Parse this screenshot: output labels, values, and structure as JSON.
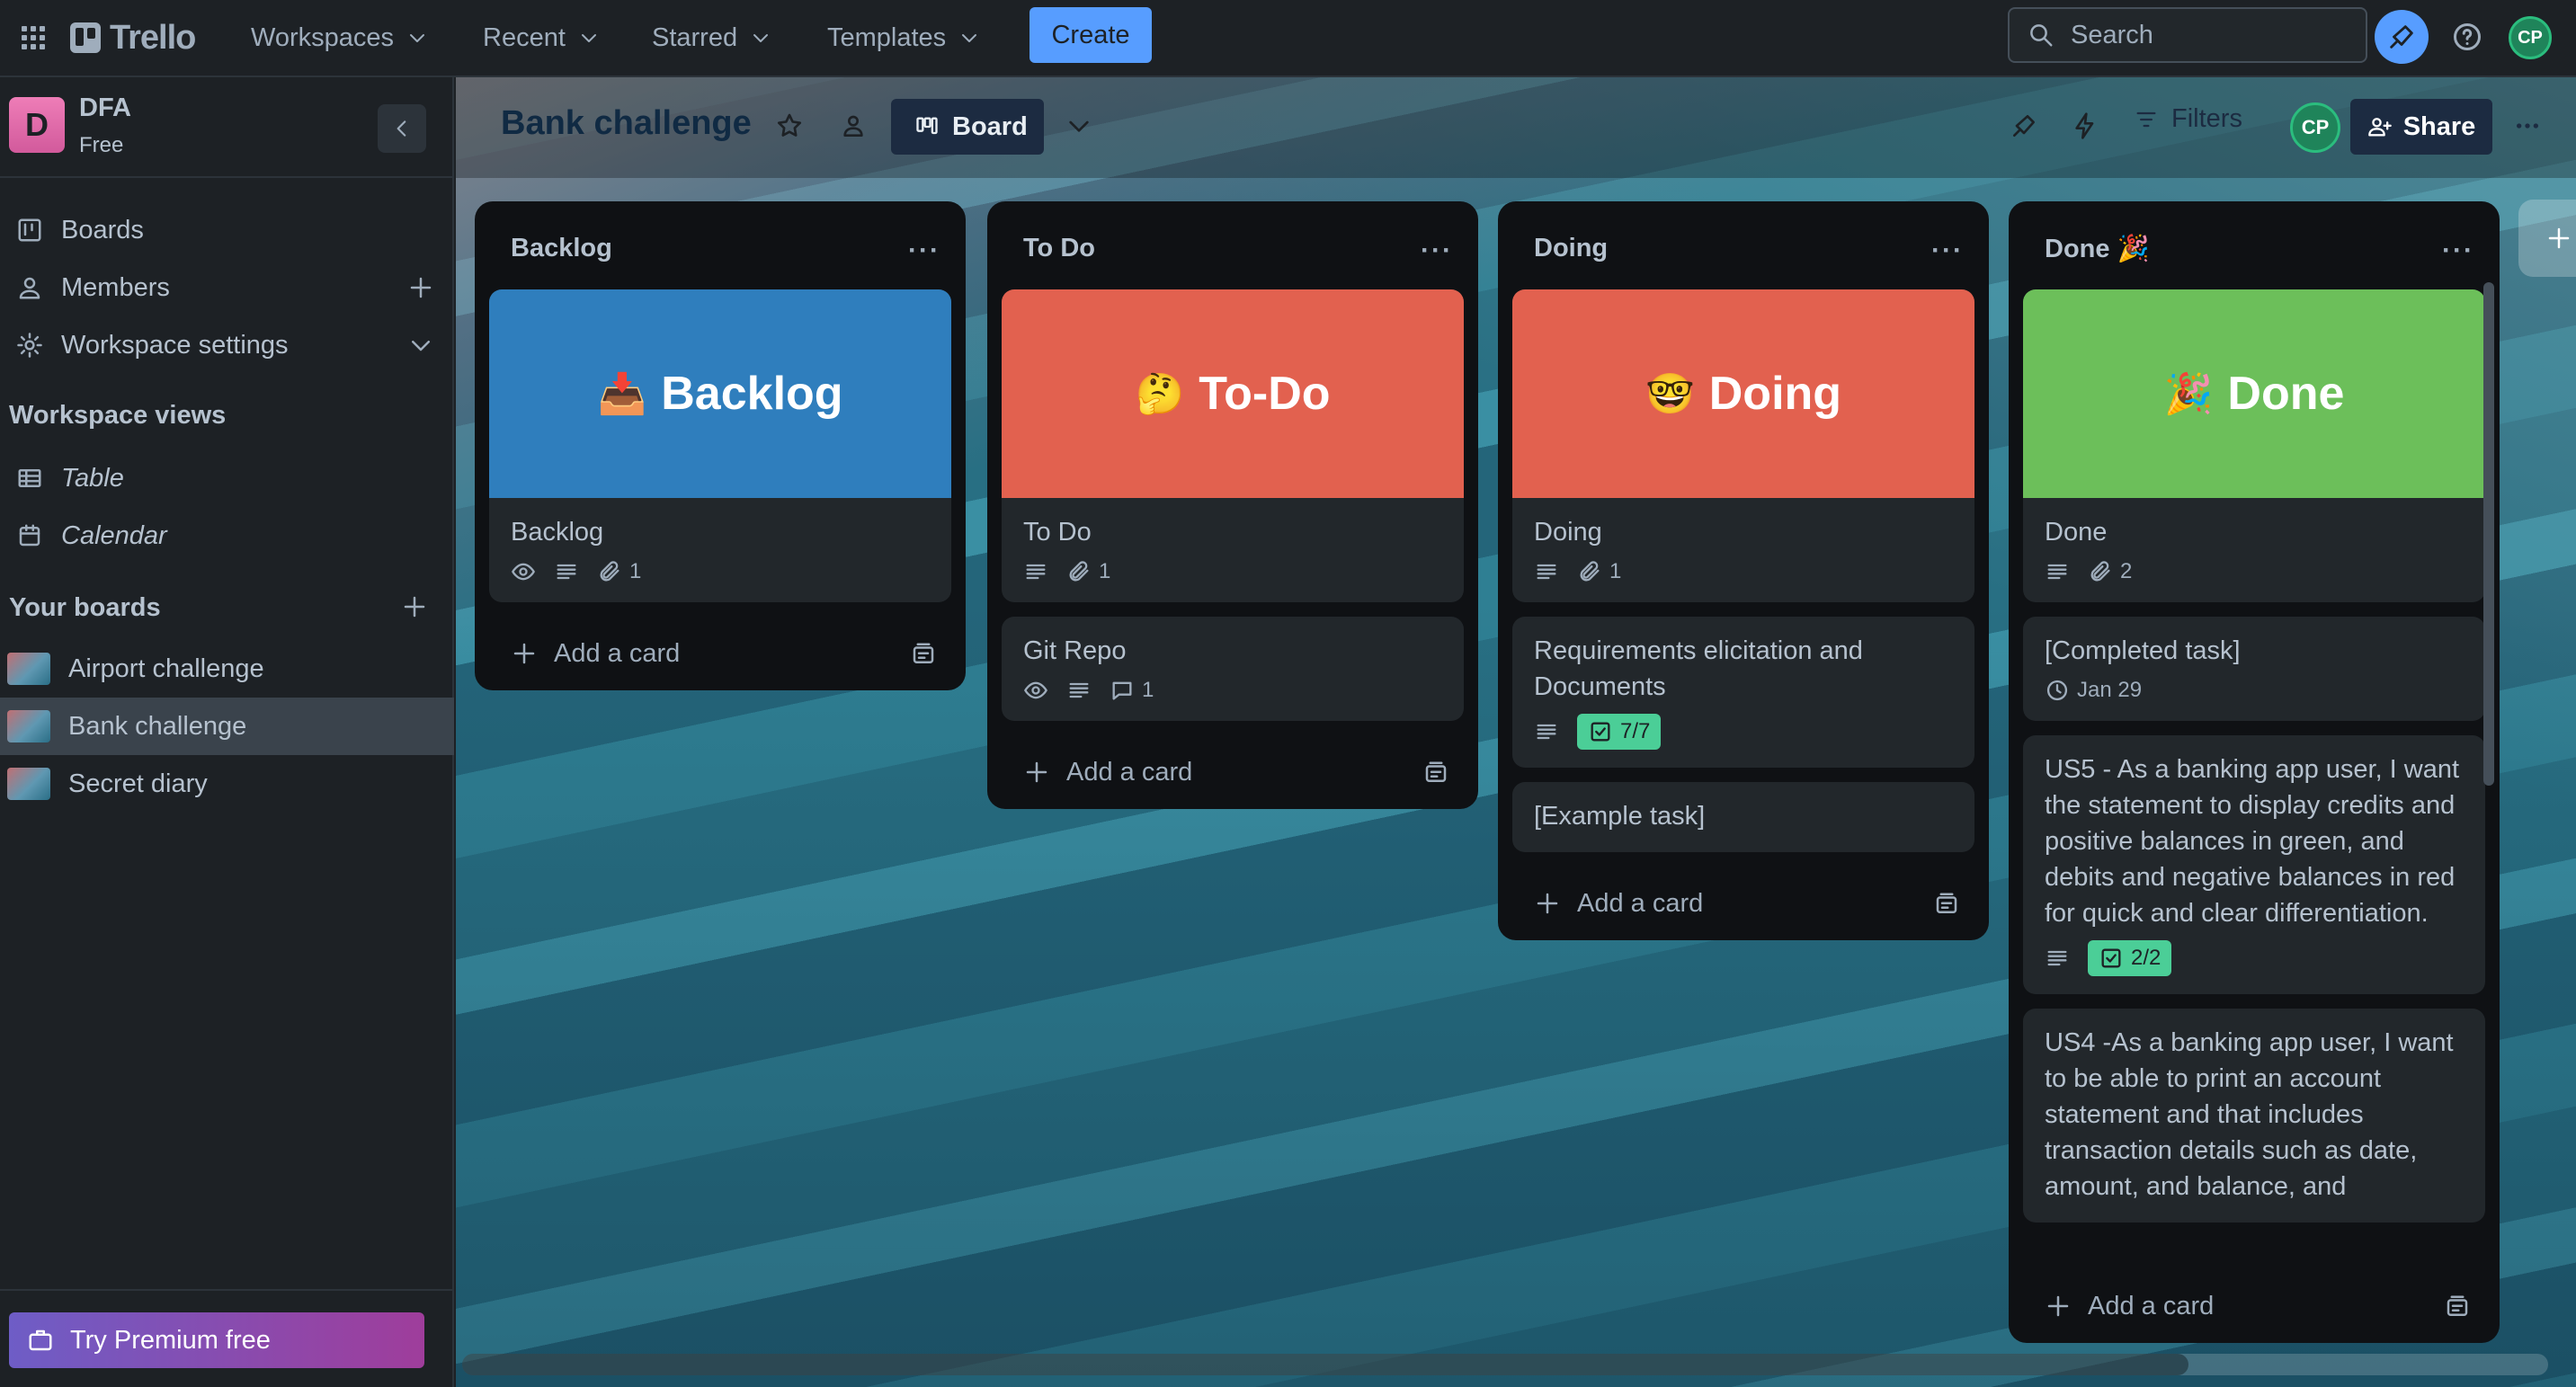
{
  "topbar": {
    "app_name": "Trello",
    "menus": [
      "Workspaces",
      "Recent",
      "Starred",
      "Templates"
    ],
    "create_label": "Create",
    "search_placeholder": "Search",
    "avatar_initials": "CP"
  },
  "sidebar": {
    "workspace_initial": "D",
    "workspace_name": "DFA",
    "workspace_plan": "Free",
    "items": [
      {
        "label": "Boards",
        "icon": "board-icon"
      },
      {
        "label": "Members",
        "icon": "person-icon"
      },
      {
        "label": "Workspace settings",
        "icon": "gear-icon"
      }
    ],
    "views_heading": "Workspace views",
    "views": [
      {
        "label": "Table",
        "icon": "table-icon"
      },
      {
        "label": "Calendar",
        "icon": "calendar-icon"
      }
    ],
    "boards_heading": "Your boards",
    "boards": [
      {
        "label": "Airport challenge"
      },
      {
        "label": "Bank challenge",
        "active": true
      },
      {
        "label": "Secret diary"
      }
    ],
    "premium_label": "Try Premium free"
  },
  "board": {
    "title": "Bank challenge",
    "view_label": "Board",
    "filters_label": "Filters",
    "share_label": "Share",
    "member_initials": "CP"
  },
  "lists": [
    {
      "title": "Backlog",
      "add_label": "Add a card",
      "cards": [
        {
          "cover_emoji": "📥",
          "cover_text": "Backlog",
          "cover_color": "#2f7ebd",
          "title": "Backlog",
          "watch": true,
          "description": true,
          "attachments": "1"
        }
      ]
    },
    {
      "title": "To Do",
      "add_label": "Add a card",
      "cards": [
        {
          "cover_emoji": "🤔",
          "cover_text": "To-Do",
          "cover_color": "#e2614f",
          "title": "To Do",
          "description": true,
          "attachments": "1"
        },
        {
          "title": "Git Repo",
          "watch": true,
          "description": true,
          "comments": "1"
        }
      ]
    },
    {
      "title": "Doing",
      "add_label": "Add a card",
      "cards": [
        {
          "cover_emoji": "🤓",
          "cover_text": "Doing",
          "cover_color": "#e2614f",
          "title": "Doing",
          "description": true,
          "attachments": "1"
        },
        {
          "title": "Requirements elicitation and Documents",
          "description": true,
          "checklist": "7/7"
        },
        {
          "title": "[Example task]"
        }
      ]
    },
    {
      "title": "Done 🎉",
      "add_label": "Add a card",
      "cards": [
        {
          "cover_emoji": "🎉",
          "cover_text": "Done",
          "cover_color": "#6cbf5a",
          "title": "Done",
          "description": true,
          "attachments": "2"
        },
        {
          "title": "[Completed task]",
          "date": "Jan 29"
        },
        {
          "title": "US5 - As a banking app user, I want the statement to display credits and positive balances in green, and debits and negative balances in red for quick and clear differentiation.",
          "description": true,
          "checklist": "2/2"
        },
        {
          "title": "US4 -As a banking app user, I want to be able to print an account statement and that includes transaction details such as date, amount, and balance, and"
        }
      ]
    }
  ]
}
